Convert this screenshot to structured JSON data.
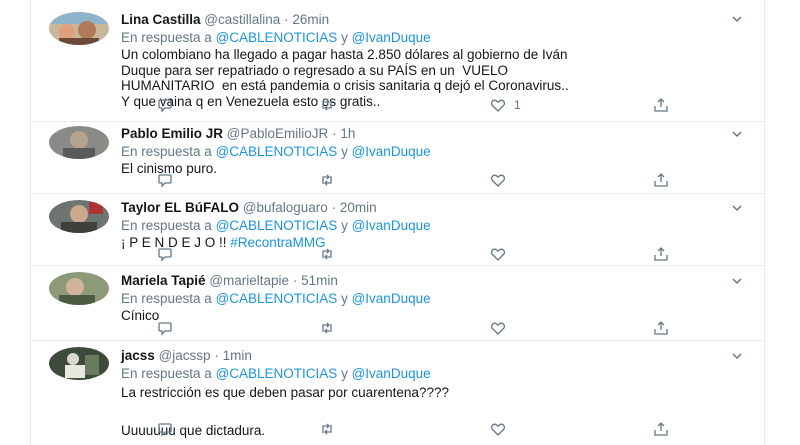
{
  "tweets": [
    {
      "name": "Lina Castilla",
      "handle": "@castillalina",
      "time": "26min",
      "reply_prefix": "En respuesta a",
      "mention1": "@CABLENOTICIAS",
      "reply_and": "y",
      "mention2": "@IvanDuque",
      "text": "Un colombiano ha llegado a pagar hasta 2.850 dólares al gobierno de Iván\nDuque para ser repatriado o regresado a su PAÍS en un  VUELO\nHUMANITARIO  en está pandemia o crisis sanitaria q dejó el Coronavirus..\nY que vaina q en Venezuela esto es gratis..",
      "reply_count": "",
      "retweet_count": "",
      "like_count": "1"
    },
    {
      "name": "Pablo Emilio JR",
      "handle": "@PabloEmilioJR",
      "time": "1h",
      "reply_prefix": "En respuesta a",
      "mention1": "@CABLENOTICIAS",
      "reply_and": "y",
      "mention2": "@IvanDuque",
      "text": "El cinismo puro.",
      "reply_count": "",
      "retweet_count": "",
      "like_count": ""
    },
    {
      "name": "Taylor EL BúFALO",
      "handle": "@bufaloguaro",
      "time": "20min",
      "reply_prefix": "En respuesta a",
      "mention1": "@CABLENOTICIAS",
      "reply_and": "y",
      "mention2": "@IvanDuque",
      "text_plain": "¡ P E N D E J O !! ",
      "hashtag": "#RecontraMMG",
      "reply_count": "",
      "retweet_count": "",
      "like_count": ""
    },
    {
      "name": "Mariela Tapié",
      "handle": "@marieltapie",
      "time": "51min",
      "reply_prefix": "En respuesta a",
      "mention1": "@CABLENOTICIAS",
      "reply_and": "y",
      "mention2": "@IvanDuque",
      "text": "Cínico",
      "reply_count": "",
      "retweet_count": "",
      "like_count": ""
    },
    {
      "name": "jacss",
      "handle": "@jacssp",
      "time": "1min",
      "reply_prefix": "En respuesta a",
      "mention1": "@CABLENOTICIAS",
      "reply_and": "y",
      "mention2": "@IvanDuque",
      "text": "La restricción es que deben pasar por cuarentena????\n\nUuuuuuu que dictadura.",
      "reply_count": "",
      "retweet_count": "",
      "like_count": ""
    }
  ],
  "separator": "·",
  "colors": {
    "accent": "#1b95e0",
    "muted": "#657786",
    "border": "#e6ecf0"
  },
  "icons": [
    "reply-icon",
    "retweet-icon",
    "like-icon",
    "share-icon",
    "chevron-down-icon"
  ]
}
